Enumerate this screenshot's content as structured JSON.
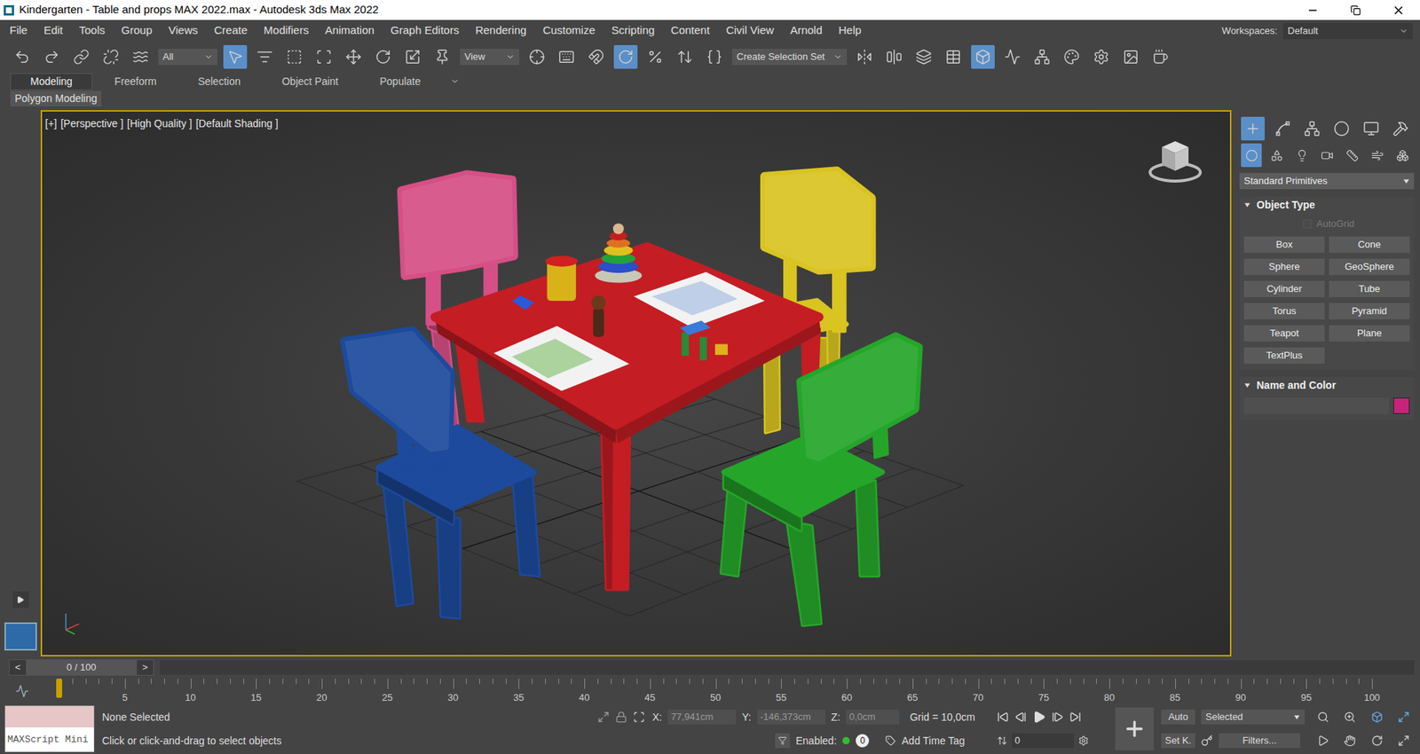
{
  "window": {
    "title": "Kindergarten - Table and props MAX 2022.max - Autodesk 3ds Max 2022"
  },
  "menu": {
    "items": [
      "File",
      "Edit",
      "Tools",
      "Group",
      "Views",
      "Create",
      "Modifiers",
      "Animation",
      "Graph Editors",
      "Rendering",
      "Customize",
      "Scripting",
      "Content",
      "Civil View",
      "Arnold",
      "Help"
    ],
    "workspaces_label": "Workspaces:",
    "workspace": "Default"
  },
  "toolbar": {
    "filter": "All",
    "ref_coord": "View",
    "selection_set": "Create Selection Set"
  },
  "ribbon": {
    "tabs": [
      {
        "label": "Modeling",
        "selected": true
      },
      {
        "label": "Freeform",
        "selected": false
      },
      {
        "label": "Selection",
        "selected": false
      },
      {
        "label": "Object Paint",
        "selected": false
      },
      {
        "label": "Populate",
        "selected": false
      }
    ],
    "panel": "Polygon Modeling"
  },
  "viewport": {
    "labels": [
      "[+]",
      "[Perspective ]",
      "[High Quality ]",
      "[Default Shading ]"
    ],
    "active": true,
    "scene": {
      "table": {
        "color": "#c41d24"
      },
      "chairs": [
        {
          "name": "pink-chair",
          "color": "#d64f86"
        },
        {
          "name": "yellow-chair",
          "color": "#d9c421"
        },
        {
          "name": "blue-chair",
          "color": "#1d4a9c"
        },
        {
          "name": "green-chair",
          "color": "#25a62a"
        }
      ]
    }
  },
  "command_panel": {
    "category": "Standard Primitives",
    "object_type": {
      "title": "Object Type",
      "autogrid": {
        "label": "AutoGrid",
        "checked": false,
        "disabled": true
      },
      "buttons": [
        "Box",
        "Cone",
        "Sphere",
        "GeoSphere",
        "Cylinder",
        "Tube",
        "Torus",
        "Pyramid",
        "Teapot",
        "Plane",
        "TextPlus"
      ]
    },
    "name_color": {
      "title": "Name and Color",
      "name": "",
      "color": "#c8237a"
    }
  },
  "timeline": {
    "frame": "0 / 100",
    "prev": "<",
    "next": ">",
    "level": 0,
    "ticks": [
      "5",
      "10",
      "15",
      "20",
      "25",
      "30",
      "35",
      "40",
      "45",
      "50",
      "55",
      "60",
      "65",
      "70",
      "75",
      "80",
      "85",
      "90",
      "95",
      "100"
    ]
  },
  "status": {
    "maxscript": "MAXScript Mini",
    "selection": "None Selected",
    "prompt": "Click or click-and-drag to select objects",
    "x_label": "X:",
    "x": "77,941cm",
    "y_label": "Y:",
    "y": "-146,373cm",
    "z_label": "Z:",
    "z": "0,0cm",
    "grid": "Grid = 10,0cm",
    "enabled_label": "Enabled:",
    "enabled": true,
    "counter": "0",
    "add_time_tag": "Add Time Tag",
    "auto": "Auto",
    "key_filter": "Selected",
    "set_key": "Set K.",
    "filters": "Filters...",
    "frame": "0"
  }
}
